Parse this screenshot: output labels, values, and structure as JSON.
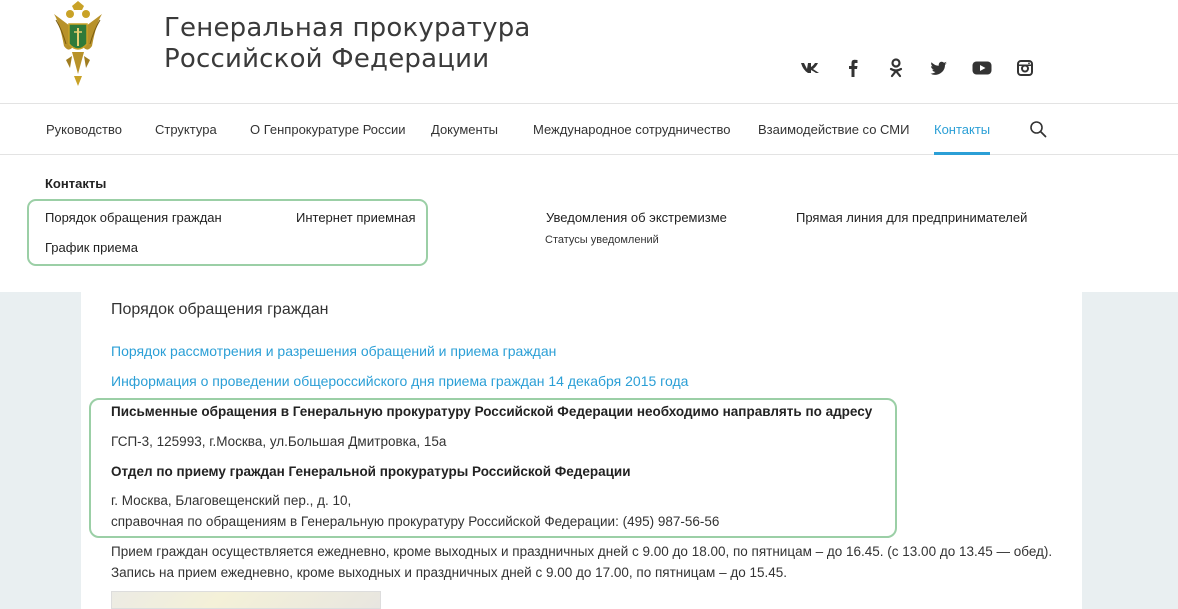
{
  "header": {
    "title_line1": "Генеральная прокуратура",
    "title_line2": "Российской Федерации"
  },
  "social": [
    {
      "icon": "vk-icon",
      "glyph": "vk"
    },
    {
      "icon": "facebook-icon",
      "glyph": "f"
    },
    {
      "icon": "odnoklassniki-icon",
      "glyph": "ok"
    },
    {
      "icon": "twitter-icon",
      "glyph": "tw"
    },
    {
      "icon": "youtube-icon",
      "glyph": "yt"
    },
    {
      "icon": "instagram-icon",
      "glyph": "ig"
    }
  ],
  "nav": {
    "items": [
      "Руководство",
      "Структура",
      "О Генпрокуратуре России",
      "Документы",
      "Международное сотрудничество",
      "Взаимодействие со СМИ",
      "Контакты"
    ],
    "active": "Контакты"
  },
  "dropdown": {
    "title": "Контакты",
    "links": {
      "order": "Порядок обращения граждан",
      "internet": "Интернет приемная",
      "schedule": "График приема",
      "extremism": "Уведомления об экстремизме",
      "statuses": "Статусы уведомлений",
      "direct_line": "Прямая линия для предпринимателей"
    }
  },
  "content": {
    "title": "Порядок обращения граждан",
    "link1": "Порядок рассмотрения и разрешения обращений и приема граждан",
    "link2": "Информация о проведении общероссийского дня приема граждан 14 декабря 2015 года",
    "bold1": "Письменные обращения в Генеральную прокуратуру Российской Федерации необходимо направлять по адресу",
    "address1": "ГСП-3, 125993, г.Москва, ул.Большая Дмитровка, 15а",
    "bold2": "Отдел по приему граждан Генеральной прокуратуры Российской Федерации",
    "address2": "г. Москва, Благовещенский пер., д. 10,",
    "phone_line": "справочная по обращениям в Генеральную прокуратуру Российской Федерации: (495) 987-56-56",
    "paragraph": "Прием граждан осуществляется ежедневно, кроме выходных и праздничных дней с 9.00 до 18.00, по пятницам – до 16.45. (с 13.00 до 13.45 — обед). Запись на прием ежедневно, кроме выходных и праздничных дней с 9.00 до 17.00, по пятницам – до 15.45."
  },
  "colors": {
    "accent": "#2b9fd6",
    "highlight_border": "#9bcfa6",
    "side_background": "#e9eff1"
  }
}
